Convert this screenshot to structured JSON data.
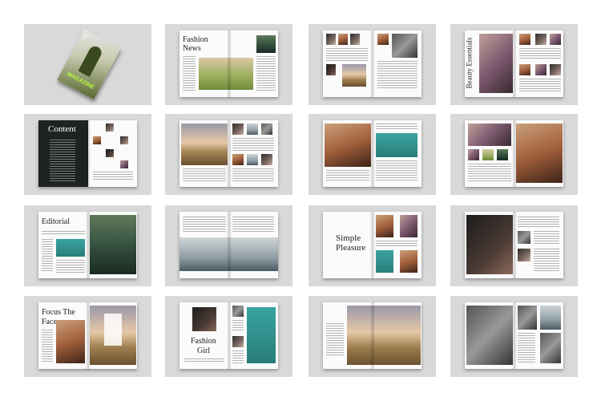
{
  "magazine": {
    "cover_title": "MAGAZINE",
    "cover_letter": "F"
  },
  "spreads": [
    {
      "heading": "Fashion News"
    },
    {
      "heading": ""
    },
    {
      "heading": ""
    },
    {
      "heading": "Beauty Essentials"
    },
    {
      "heading": "Content"
    },
    {
      "heading": ""
    },
    {
      "heading": ""
    },
    {
      "heading": ""
    },
    {
      "heading": "Editorial"
    },
    {
      "heading": ""
    },
    {
      "heading_line1": "Simple",
      "heading_line2": "Pleasure"
    },
    {
      "heading": ""
    },
    {
      "heading_line1": "Focus The",
      "heading_line2": "Face"
    },
    {
      "heading_line1": "Fashion",
      "heading_line2": "Girl"
    },
    {
      "heading": ""
    },
    {
      "heading": ""
    }
  ]
}
